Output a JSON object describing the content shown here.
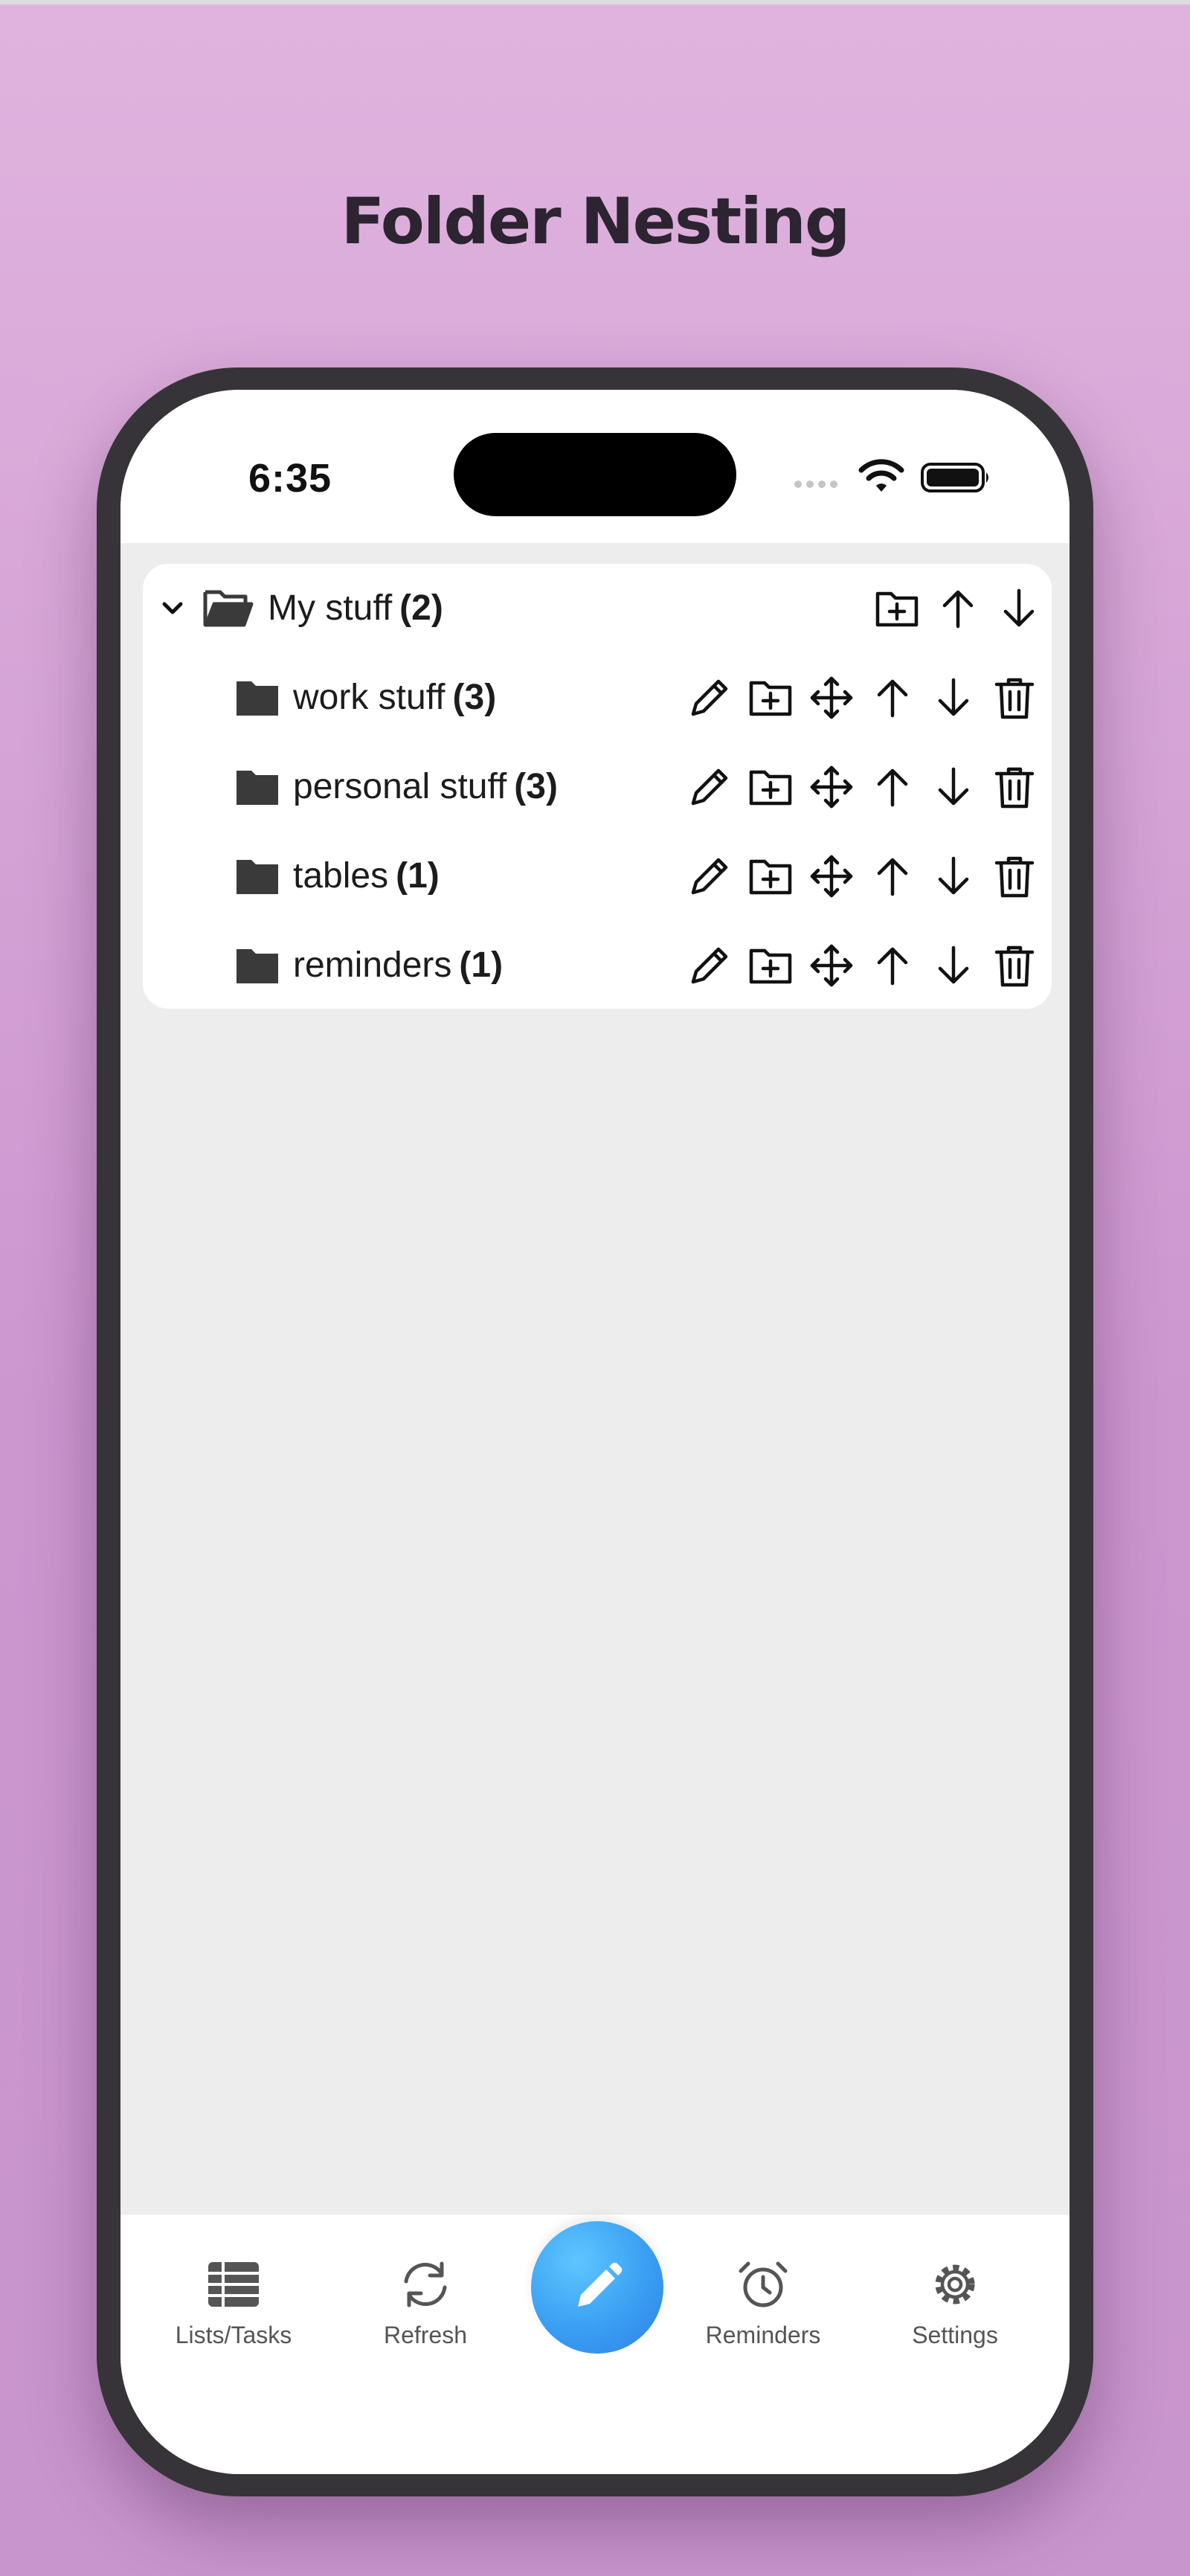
{
  "promo_title": "Folder Nesting",
  "status_bar": {
    "time": "6:35"
  },
  "folders": {
    "root": {
      "name": "My stuff",
      "count": "(2)"
    },
    "children": [
      {
        "name": "work stuff",
        "count": "(3)"
      },
      {
        "name": "personal stuff",
        "count": "(3)"
      },
      {
        "name": "tables",
        "count": "(1)"
      },
      {
        "name": "reminders",
        "count": "(1)"
      }
    ]
  },
  "tab_bar": {
    "lists": "Lists/Tasks",
    "refresh": "Refresh",
    "reminders": "Reminders",
    "settings": "Settings"
  },
  "icons": {
    "status": [
      "signal-dots-icon",
      "wifi-icon",
      "battery-icon"
    ],
    "root_actions": [
      "folder-add-icon",
      "arrow-up-icon",
      "arrow-down-icon"
    ],
    "child_actions": [
      "pencil-icon",
      "folder-add-icon",
      "move-icon",
      "arrow-up-icon",
      "arrow-down-icon",
      "trash-icon"
    ],
    "tabs": [
      "list-icon",
      "refresh-icon",
      "pencil-icon",
      "alarm-clock-icon",
      "gear-icon"
    ]
  },
  "colors": {
    "background_top": "#e0b3de",
    "background_bottom": "#c895cc",
    "phone_frame": "#363438",
    "content_bg": "#ededed",
    "fab_accent": "#3a9ff2"
  }
}
